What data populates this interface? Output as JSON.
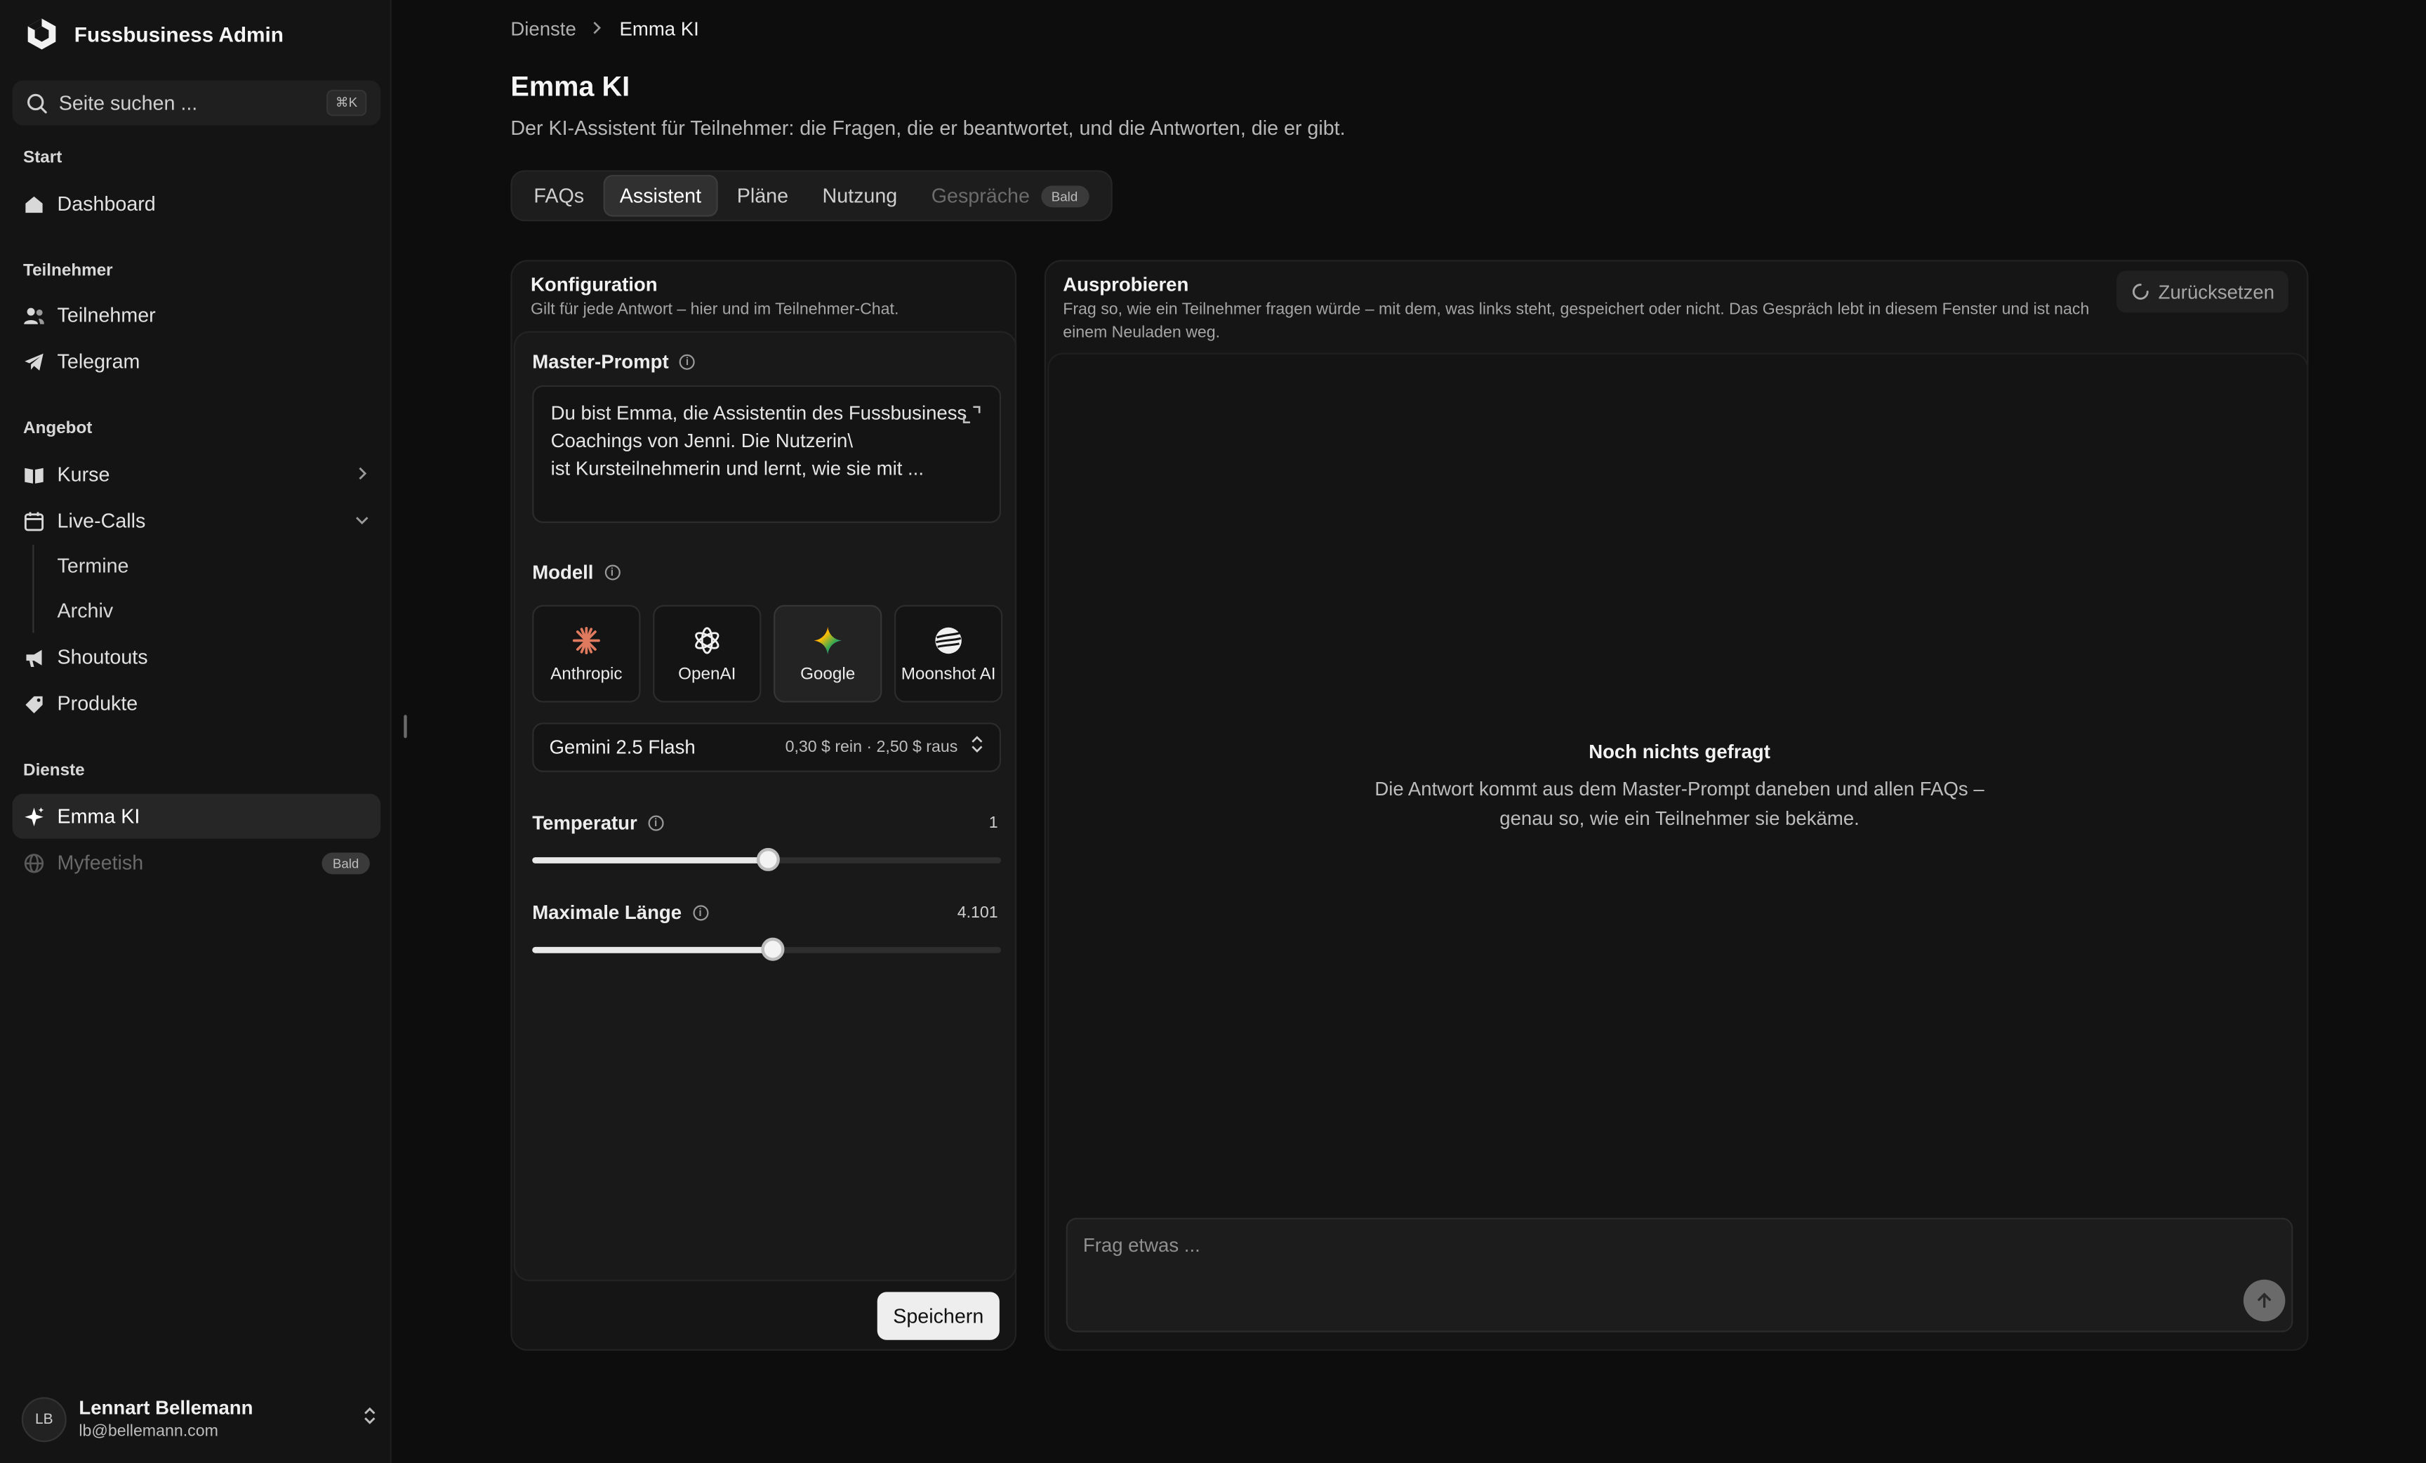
{
  "app": {
    "name": "Fussbusiness Admin"
  },
  "search": {
    "placeholder": "Seite suchen ...",
    "shortcut": "⌘K"
  },
  "sidebar": {
    "groups": {
      "start": "Start",
      "teilnehmer": "Teilnehmer",
      "angebot": "Angebot",
      "dienste": "Dienste"
    },
    "items": {
      "dashboard": "Dashboard",
      "teilnehmer": "Teilnehmer",
      "telegram": "Telegram",
      "kurse": "Kurse",
      "livecalls": "Live-Calls",
      "termine": "Termine",
      "archiv": "Archiv",
      "shoutouts": "Shoutouts",
      "produkte": "Produkte",
      "emma": "Emma KI",
      "myfeetish": "Myfeetish",
      "myfeetish_badge": "Bald"
    }
  },
  "user": {
    "initials": "LB",
    "name": "Lennart Bellemann",
    "email": "lb@bellemann.com"
  },
  "breadcrumb": {
    "parent": "Dienste",
    "current": "Emma KI"
  },
  "page": {
    "title": "Emma KI",
    "subtitle": "Der KI-Assistent für Teilnehmer: die Fragen, die er beantwortet, und die Antworten, die er gibt."
  },
  "tabs": {
    "faqs": "FAQs",
    "assistent": "Assistent",
    "plaene": "Pläne",
    "nutzung": "Nutzung",
    "gespraeche": "Gespräche",
    "gespraeche_badge": "Bald"
  },
  "config": {
    "title": "Konfiguration",
    "subtitle": "Gilt für jede Antwort – hier und im Teilnehmer-Chat.",
    "prompt_label": "Master-Prompt",
    "prompt_text": "Du bist Emma, die Assistentin des Fussbusiness Coachings von Jenni. Die Nutzerin\\\nist Kursteilnehmerin und lernt, wie sie mit ...",
    "model_label": "Modell",
    "providers": {
      "anthropic": "Anthropic",
      "openai": "OpenAI",
      "google": "Google",
      "moonshot": "Moonshot AI"
    },
    "selected_model": "Gemini 2.5 Flash",
    "model_price": "0,30 $ rein · 2,50 $ raus",
    "temperature_label": "Temperatur",
    "temperature_value": "1",
    "temperature_fraction": 0.5,
    "maxlen_label": "Maximale Länge",
    "maxlen_value": "4.101",
    "maxlen_fraction": 0.51,
    "save_label": "Speichern"
  },
  "playground": {
    "title": "Ausprobieren",
    "subtitle": "Frag so, wie ein Teilnehmer fragen würde – mit dem, was links steht, gespeichert oder nicht. Das Gespräch lebt in diesem Fenster und ist nach einem Neuladen weg.",
    "reset_label": "Zurücksetzen",
    "empty_title": "Noch nichts gefragt",
    "empty_subtitle": "Die Antwort kommt aus dem Master-Prompt daneben und allen FAQs – genau so, wie ein Teilnehmer sie bekäme.",
    "input_placeholder": "Frag etwas ..."
  }
}
